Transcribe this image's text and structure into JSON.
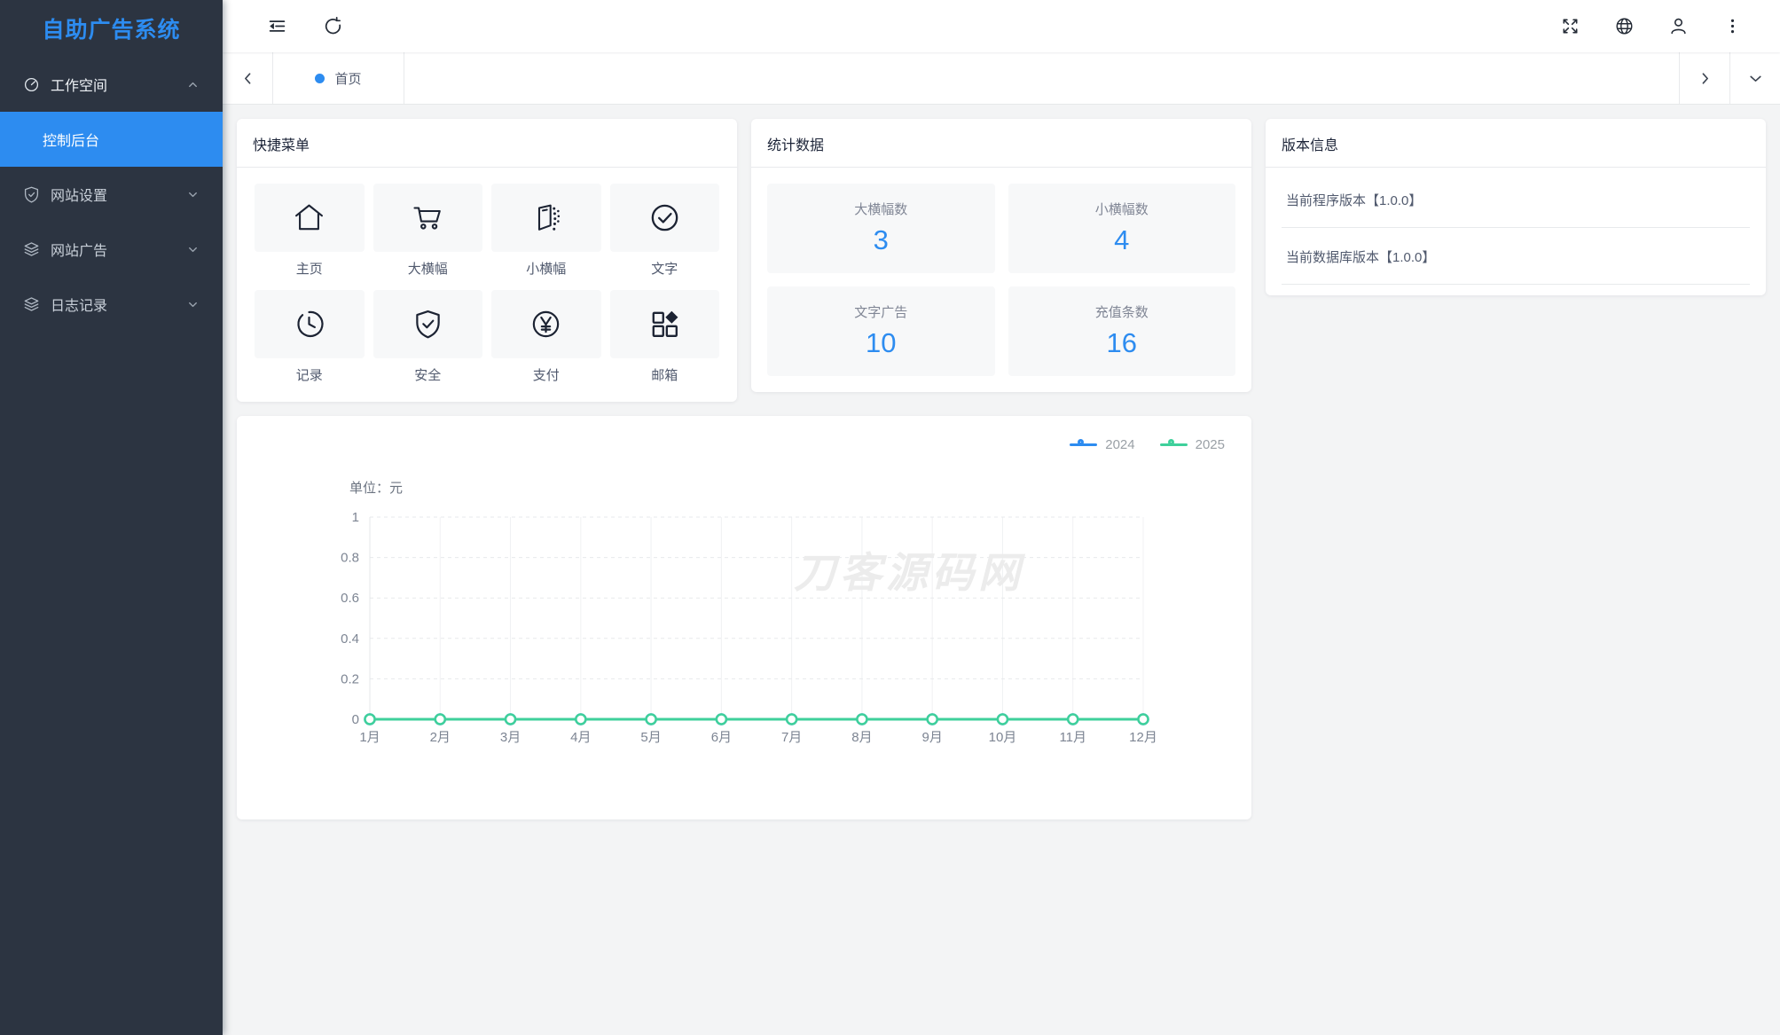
{
  "app": {
    "title": "自助广告系统"
  },
  "colors": {
    "accent": "#2d8cf0",
    "sidebar_bg": "#2c3441",
    "series_2024": "#2d8cf0",
    "series_2025": "#3fd09b"
  },
  "sidebar": {
    "title": "自助广告系统",
    "items": [
      {
        "label": "工作空间",
        "icon": "gauge-icon",
        "state": "expanded"
      },
      {
        "label": "网站设置",
        "icon": "shield-icon",
        "state": "collapsed"
      },
      {
        "label": "网站广告",
        "icon": "layers-icon",
        "state": "collapsed"
      },
      {
        "label": "日志记录",
        "icon": "layers-icon",
        "state": "collapsed"
      }
    ],
    "active_submenu": "控制后台"
  },
  "tabs": {
    "active": "首页"
  },
  "cards": {
    "quick_menu": {
      "title": "快捷菜单",
      "items": [
        {
          "label": "主页",
          "icon": "home-icon"
        },
        {
          "label": "大横幅",
          "icon": "cart-icon"
        },
        {
          "label": "小横幅",
          "icon": "banner-icon"
        },
        {
          "label": "文字",
          "icon": "check-circle-icon"
        },
        {
          "label": "记录",
          "icon": "clock-icon"
        },
        {
          "label": "安全",
          "icon": "shield-check-icon"
        },
        {
          "label": "支付",
          "icon": "yen-circle-icon"
        },
        {
          "label": "邮箱",
          "icon": "apps-icon"
        }
      ]
    },
    "stats": {
      "title": "统计数据",
      "items": [
        {
          "label": "大横幅数",
          "value": "3"
        },
        {
          "label": "小横幅数",
          "value": "4"
        },
        {
          "label": "文字广告",
          "value": "10"
        },
        {
          "label": "充值条数",
          "value": "16"
        }
      ]
    },
    "version": {
      "title": "版本信息",
      "items": [
        "当前程序版本【1.0.0】",
        "当前数据库版本【1.0.0】"
      ]
    }
  },
  "chart_data": {
    "type": "line",
    "title": "",
    "unit_label": "单位：元",
    "watermark": "刀客源码网",
    "categories": [
      "1月",
      "2月",
      "3月",
      "4月",
      "5月",
      "6月",
      "7月",
      "8月",
      "9月",
      "10月",
      "11月",
      "12月"
    ],
    "series": [
      {
        "name": "2024",
        "color": "#2d8cf0",
        "values": [
          0,
          0,
          0,
          0,
          0,
          0,
          0,
          0,
          0,
          0,
          0,
          0
        ]
      },
      {
        "name": "2025",
        "color": "#3fd09b",
        "values": [
          0,
          0,
          0,
          0,
          0,
          0,
          0,
          0,
          0,
          0,
          0,
          0
        ]
      }
    ],
    "ylim": [
      0,
      1
    ],
    "yticks": [
      0,
      0.2,
      0.4,
      0.6,
      0.8,
      1
    ],
    "grid": true,
    "legend_position": "top-right"
  }
}
